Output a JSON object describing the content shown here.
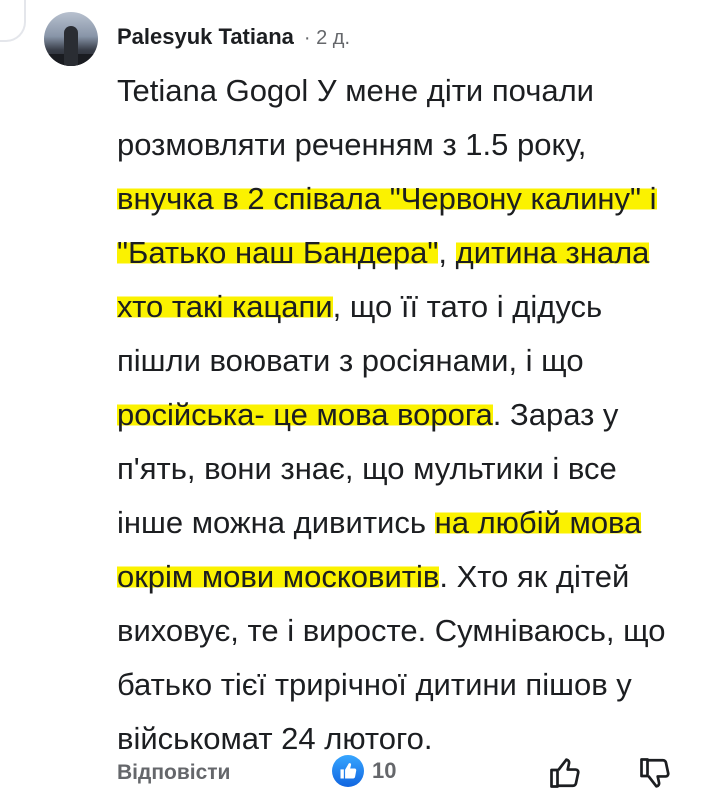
{
  "comment": {
    "author": "Palesyuk Tatiana",
    "time": "· 2 д.",
    "segments": [
      {
        "text": "Tetiana Gogol У мене діти почали розмовляти реченням з 1.5 року, ",
        "highlight": false
      },
      {
        "text": "внучка в 2  співала \"Червону калину\" і \"Батько наш Бандера\"",
        "highlight": true
      },
      {
        "text": ", ",
        "highlight": false
      },
      {
        "text": "дитина знала хто такі кацапи",
        "highlight": true
      },
      {
        "text": ", що її тато і дідусь пішли воювати з росіянами, і що ",
        "highlight": false
      },
      {
        "text": "російська- це мова ворога",
        "highlight": true
      },
      {
        "text": ". Зараз у п'ять, вони знає, що мультики і все інше можна дивитись ",
        "highlight": false
      },
      {
        "text": "на любій мова окрім мови московитів",
        "highlight": true
      },
      {
        "text": ". Хто як дітей виховує, те і виросте. Сумніваюсь, що батько тієї трирічної дитини пішов у військомат 24 лютого.",
        "highlight": false
      }
    ]
  },
  "actions": {
    "reply_label": "Відповісти",
    "reaction_icon": "like-badge-icon",
    "reaction_count": "10"
  },
  "colors": {
    "highlight": "#fbf200",
    "like_blue": "#1877f2",
    "muted_text": "#65676b"
  }
}
